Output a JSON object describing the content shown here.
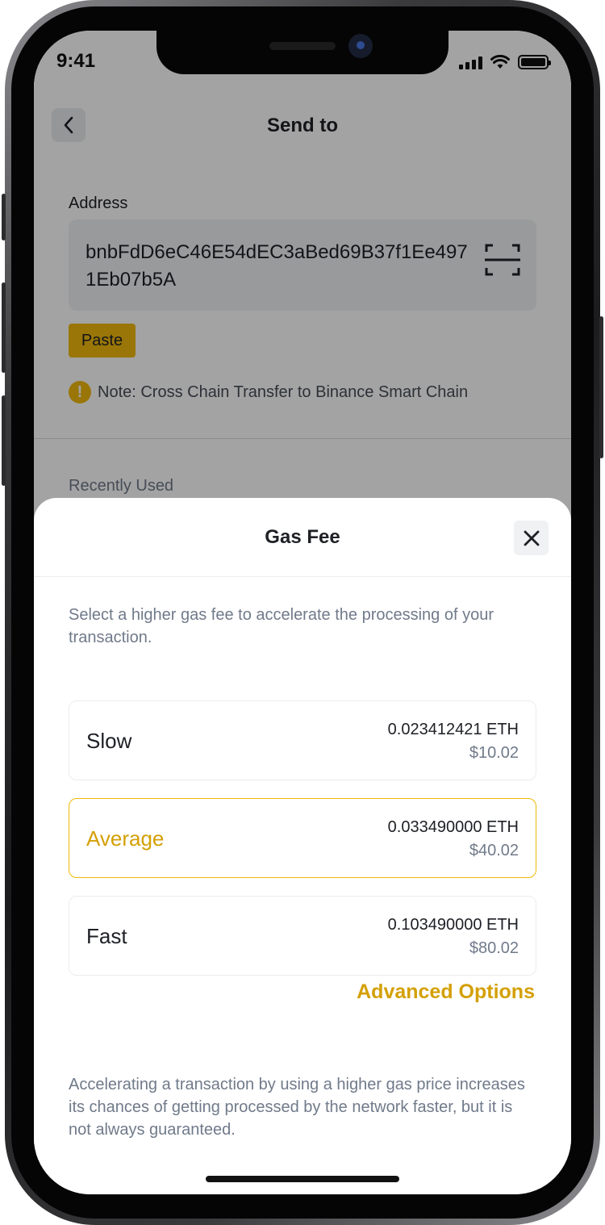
{
  "status_bar": {
    "time": "9:41"
  },
  "page": {
    "title": "Send to",
    "address_label": "Address",
    "address_value": "bnbFdD6eC46E54dEC3aBed69B37f1Ee4971Eb07b5A",
    "paste_label": "Paste",
    "note_text": "Note: Cross Chain Transfer to Binance Smart Chain",
    "recently_used_label": "Recently Used"
  },
  "sheet": {
    "title": "Gas Fee",
    "description": "Select a higher gas fee to accelerate the processing of your transaction.",
    "options": [
      {
        "name": "Slow",
        "eth": "0.023412421 ETH",
        "usd": "$10.02",
        "selected": false
      },
      {
        "name": "Average",
        "eth": "0.033490000 ETH",
        "usd": "$40.02",
        "selected": true
      },
      {
        "name": "Fast",
        "eth": "0.103490000 ETH",
        "usd": "$80.02",
        "selected": false
      }
    ],
    "advanced_label": "Advanced Options",
    "footer_note": "Accelerating a transaction by using a higher gas price increases its chances of getting processed by the network faster, but it is not always guaranteed."
  },
  "colors": {
    "accent": "#F0B90B",
    "accent_text": "#D4A006",
    "primary_text": "#1E2026",
    "secondary_text": "#707A8A"
  }
}
